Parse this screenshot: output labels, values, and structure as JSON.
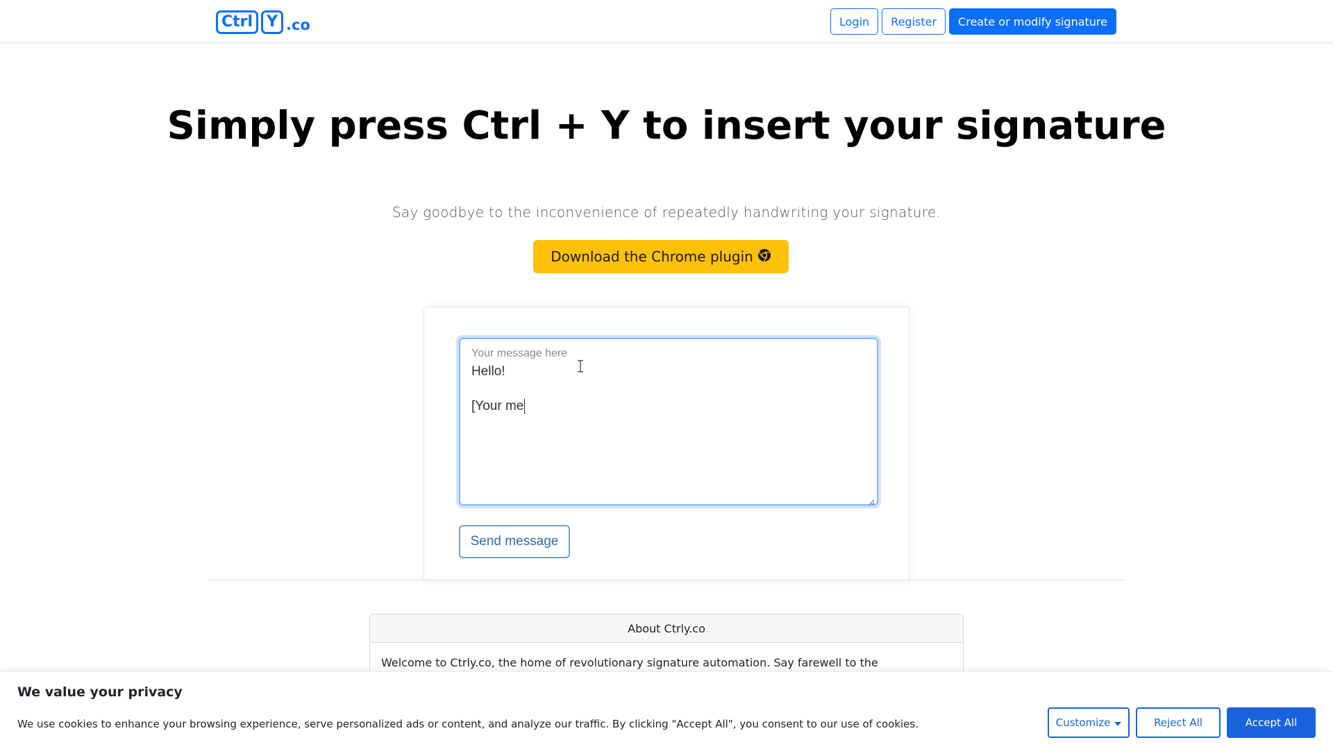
{
  "header": {
    "logo": {
      "key1": "Ctrl",
      "key2": "Y",
      "domain": ".co"
    },
    "login_label": "Login",
    "register_label": "Register",
    "signature_label": "Create or modify signature"
  },
  "hero": {
    "title": "Simply press Ctrl + Y to insert your signature",
    "subtitle": "Say goodbye to the inconvenience of repeatedly handwriting your signature.",
    "download_label": "Download the Chrome plugin",
    "download_icon": "chrome-icon"
  },
  "demo": {
    "placeholder": "Your message here",
    "line1": "Hello!",
    "line2": "[Your me",
    "send_label": "Send message"
  },
  "about": {
    "title": "About Ctrly.co",
    "body": "Welcome to Ctrly.co, the home of revolutionary signature automation. Say farewell to the"
  },
  "cookie": {
    "title": "We value your privacy",
    "text": "We use cookies to enhance your browsing experience, serve personalized ads or content, and analyze our traffic. By clicking \"Accept All\", you consent to our use of cookies.",
    "customize_label": "Customize",
    "reject_label": "Reject All",
    "accept_label": "Accept All"
  },
  "colors": {
    "primary": "#0d6efd",
    "warning": "#ffc107",
    "cookie_accent": "#1863dc"
  }
}
